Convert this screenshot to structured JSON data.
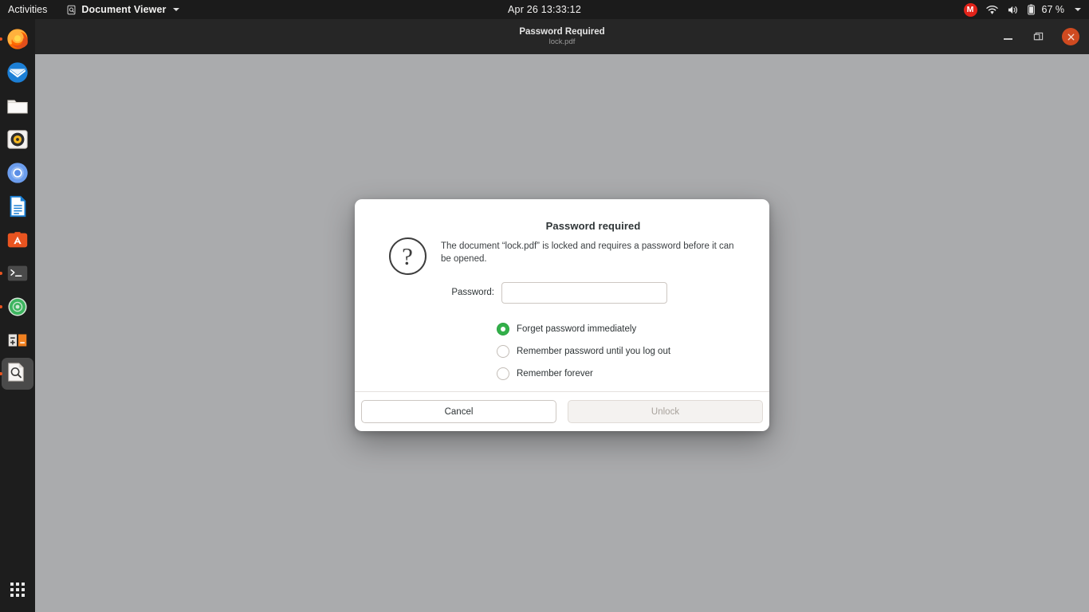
{
  "topbar": {
    "activities": "Activities",
    "app_name": "Document Viewer",
    "app_icon": "document-viewer-icon",
    "clock": "Apr 26  13:33:12",
    "user_badge": "M",
    "battery_percent": "67 %",
    "icons": [
      "wifi-icon",
      "volume-icon",
      "battery-icon",
      "chevron-down-icon"
    ]
  },
  "dock": {
    "items": [
      {
        "name": "firefox",
        "label": "Firefox",
        "running": true,
        "active": false
      },
      {
        "name": "thunderbird",
        "label": "Thunderbird Mail",
        "running": false,
        "active": false
      },
      {
        "name": "files",
        "label": "Files",
        "running": false,
        "active": false
      },
      {
        "name": "rhythmbox",
        "label": "Rhythmbox",
        "running": false,
        "active": false
      },
      {
        "name": "chromium",
        "label": "Chromium",
        "running": false,
        "active": false
      },
      {
        "name": "libreoffice-writer",
        "label": "LibreOffice Writer",
        "running": false,
        "active": false
      },
      {
        "name": "ubuntu-software",
        "label": "Ubuntu Software",
        "running": false,
        "active": false
      },
      {
        "name": "terminal",
        "label": "Terminal",
        "running": true,
        "active": false
      },
      {
        "name": "help",
        "label": "Help",
        "running": true,
        "active": false
      },
      {
        "name": "calculator",
        "label": "Calculator",
        "running": false,
        "active": false
      },
      {
        "name": "document-viewer",
        "label": "Document Viewer",
        "running": true,
        "active": true
      }
    ],
    "show_apps_label": "Show Applications"
  },
  "window": {
    "title": "Password Required",
    "subtitle": "lock.pdf",
    "controls": {
      "minimize": "minimize-button",
      "maximize": "maximize-button",
      "close": "close-button"
    }
  },
  "dialog": {
    "icon": "question-mark-icon",
    "heading": "Password required",
    "message": "The document “lock.pdf” is locked and requires a password before it can be opened.",
    "password_label": "Password:",
    "password_value": "",
    "password_placeholder": "",
    "options": [
      {
        "label": "Forget password immediately",
        "selected": true
      },
      {
        "label": "Remember password until you log out",
        "selected": false
      },
      {
        "label": "Remember forever",
        "selected": false
      }
    ],
    "cancel_label": "Cancel",
    "unlock_label": "Unlock",
    "unlock_disabled": true
  },
  "colors": {
    "desktop_background": "#aaabad",
    "topbar_background": "#1b1b1b",
    "dock_background": "#1d1d1d",
    "accent_green": "#33b04a",
    "close_button": "#cf4a20",
    "badge_red": "#e2231a"
  }
}
